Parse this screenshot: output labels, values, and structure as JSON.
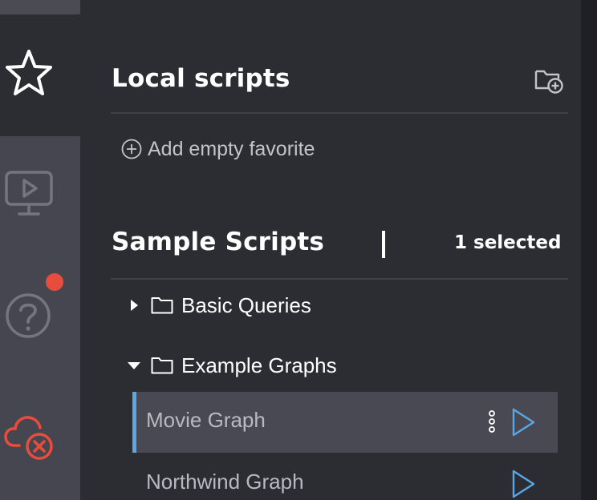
{
  "rail": {
    "items": [
      {
        "icon": "star-icon",
        "active": true
      },
      {
        "icon": "monitor-play-icon",
        "active": false
      },
      {
        "icon": "help-circle-icon",
        "active": false,
        "notification": true
      },
      {
        "icon": "cloud-disconnected-icon",
        "active": false
      }
    ]
  },
  "local_scripts": {
    "title": "Local scripts",
    "new_folder_icon": "folder-plus-icon",
    "add_favorite_label": "Add empty favorite"
  },
  "sample_scripts": {
    "title": "Sample Scripts",
    "separator": "|",
    "selected_count_label": "1 selected",
    "folders": [
      {
        "label": "Basic Queries",
        "expanded": false
      },
      {
        "label": "Example Graphs",
        "expanded": true
      }
    ],
    "scripts": [
      {
        "label": "Movie Graph",
        "selected": true
      },
      {
        "label": "Northwind Graph",
        "selected": false
      }
    ]
  },
  "colors": {
    "background": "#2b2d33",
    "rail": "#45464f",
    "accent": "#58a8e5",
    "notification": "#e84c3d",
    "disconnected": "#e84c3d"
  }
}
